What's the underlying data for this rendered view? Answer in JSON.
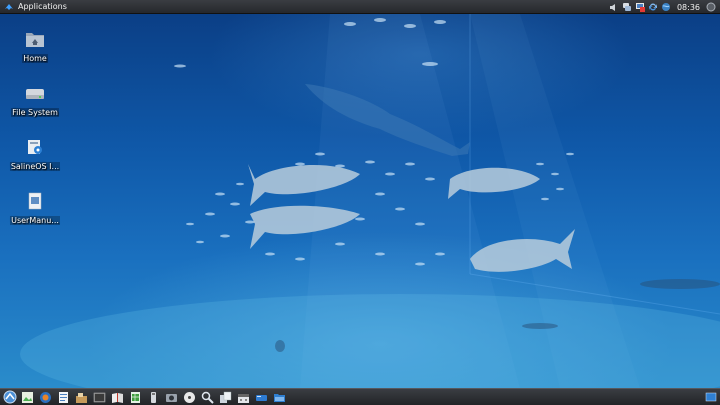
{
  "top_panel": {
    "applications_label": "Applications",
    "clock": "08:36",
    "tray_icons": [
      "speaker-icon",
      "chat-icon",
      "network-icon",
      "update-icon",
      "globe-icon"
    ]
  },
  "desktop": {
    "icons": [
      {
        "label": "Home",
        "icon": "home-folder-icon"
      },
      {
        "label": "File System",
        "icon": "drive-icon"
      },
      {
        "label": "SalineOS I...",
        "icon": "installer-icon"
      },
      {
        "label": "UserManu...",
        "icon": "document-icon"
      }
    ]
  },
  "taskbar": {
    "launchers": [
      "menu-logo-icon",
      "image-viewer-icon",
      "browser-icon",
      "text-editor-icon",
      "package-icon",
      "terminal-icon",
      "book-icon",
      "spreadsheet-icon",
      "usb-icon",
      "camera-icon",
      "disc-icon",
      "search-icon",
      "files-icon",
      "calculator-icon",
      "drive-icon",
      "folder-icon"
    ],
    "show_desktop": "show-desktop-icon"
  }
}
